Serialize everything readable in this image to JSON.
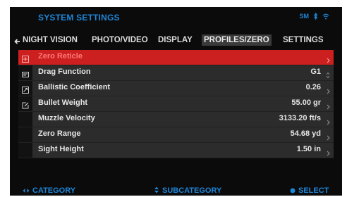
{
  "header": {
    "title": "SYSTEM SETTINGS",
    "status_label": "SM",
    "icons": [
      "bluetooth-icon",
      "wifi-icon"
    ]
  },
  "tabs": [
    {
      "label": "NIGHT VISION",
      "active": false
    },
    {
      "label": "PHOTO/VIDEO",
      "active": false
    },
    {
      "label": "DISPLAY",
      "active": false
    },
    {
      "label": "PROFILES/ZERO",
      "active": true
    },
    {
      "label": "SETTINGS",
      "active": false
    }
  ],
  "rows": [
    {
      "label": "Zero Reticle",
      "value": "",
      "icon": "crosshair-icon",
      "selected": true
    },
    {
      "label": "Drag Function",
      "value": "G1",
      "icon": "drag-function-icon",
      "selected": false
    },
    {
      "label": "Ballistic Coefficient",
      "value": "0.26",
      "icon": "ballistic-icon",
      "selected": false
    },
    {
      "label": "Bullet Weight",
      "value": "55.00 gr",
      "icon": "edit-icon",
      "selected": false
    },
    {
      "label": "Muzzle Velocity",
      "value": "3133.20 ft/s",
      "icon": "",
      "selected": false
    },
    {
      "label": "Zero Range",
      "value": "54.68 yd",
      "icon": "",
      "selected": false
    },
    {
      "label": "Sight Height",
      "value": "1.50 in",
      "icon": "",
      "selected": false
    }
  ],
  "footer": {
    "category": "CATEGORY",
    "subcategory": "SUBCATEGORY",
    "select": "SELECT"
  },
  "colors": {
    "accent_blue": "#1e86d8",
    "selected_red": "#cc1f1f",
    "row_bg": "#2c2c2c",
    "screen_bg": "#0b0b0b"
  }
}
